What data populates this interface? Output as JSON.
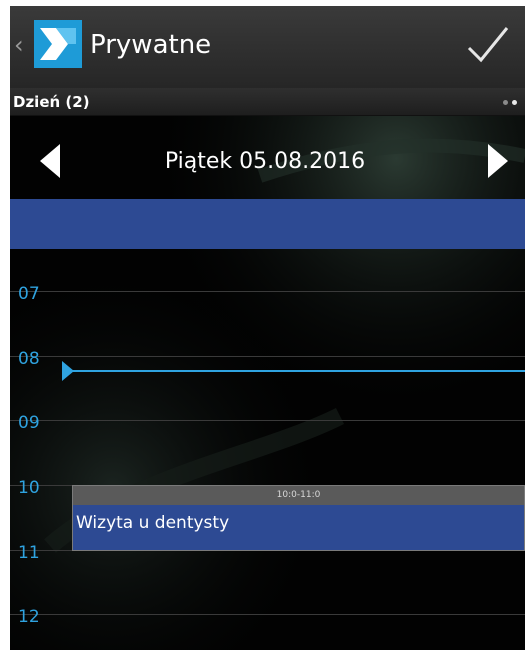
{
  "header": {
    "title": "Prywatne",
    "logo": "app-logo-icon",
    "back": "‹"
  },
  "subheader": {
    "view_label": "Dzień (2)"
  },
  "date_nav": {
    "date": "Piątek 05.08.2016"
  },
  "hours": [
    "07",
    "08",
    "09",
    "10",
    "11",
    "12"
  ],
  "event": {
    "time": "10:0-11:0",
    "title": "Wizyta u dentysty",
    "color": "#2d4a93"
  },
  "colors": {
    "accent": "#2fa3e0",
    "event_blue": "#2d4a93",
    "logo_blue": "#1e9bd7"
  }
}
